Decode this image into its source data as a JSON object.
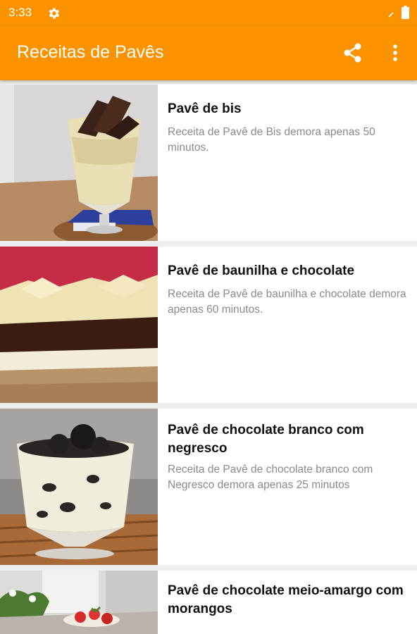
{
  "status_bar": {
    "time": "3:33",
    "icons": [
      "gear-icon",
      "signal-icon",
      "battery-icon"
    ]
  },
  "app_bar": {
    "title": "Receitas de Pavês",
    "actions": [
      "share-icon",
      "more-vert-icon"
    ],
    "color": "#fb9200"
  },
  "recipes": [
    {
      "title": "Pavê de bis",
      "description": "Receita de Pavê de Bis demora apenas 50 minutos."
    },
    {
      "title": "Pavê de baunilha e chocolate",
      "description": "Receita de Pavê de baunilha e chocolate demora apenas 60 minutos."
    },
    {
      "title": "Pavê de chocolate branco com negresco",
      "description": "Receita de Pavê de chocolate branco com Negresco demora apenas 25 minutos"
    },
    {
      "title": "Pavê de chocolate meio-amargo com morangos",
      "description": ""
    }
  ]
}
